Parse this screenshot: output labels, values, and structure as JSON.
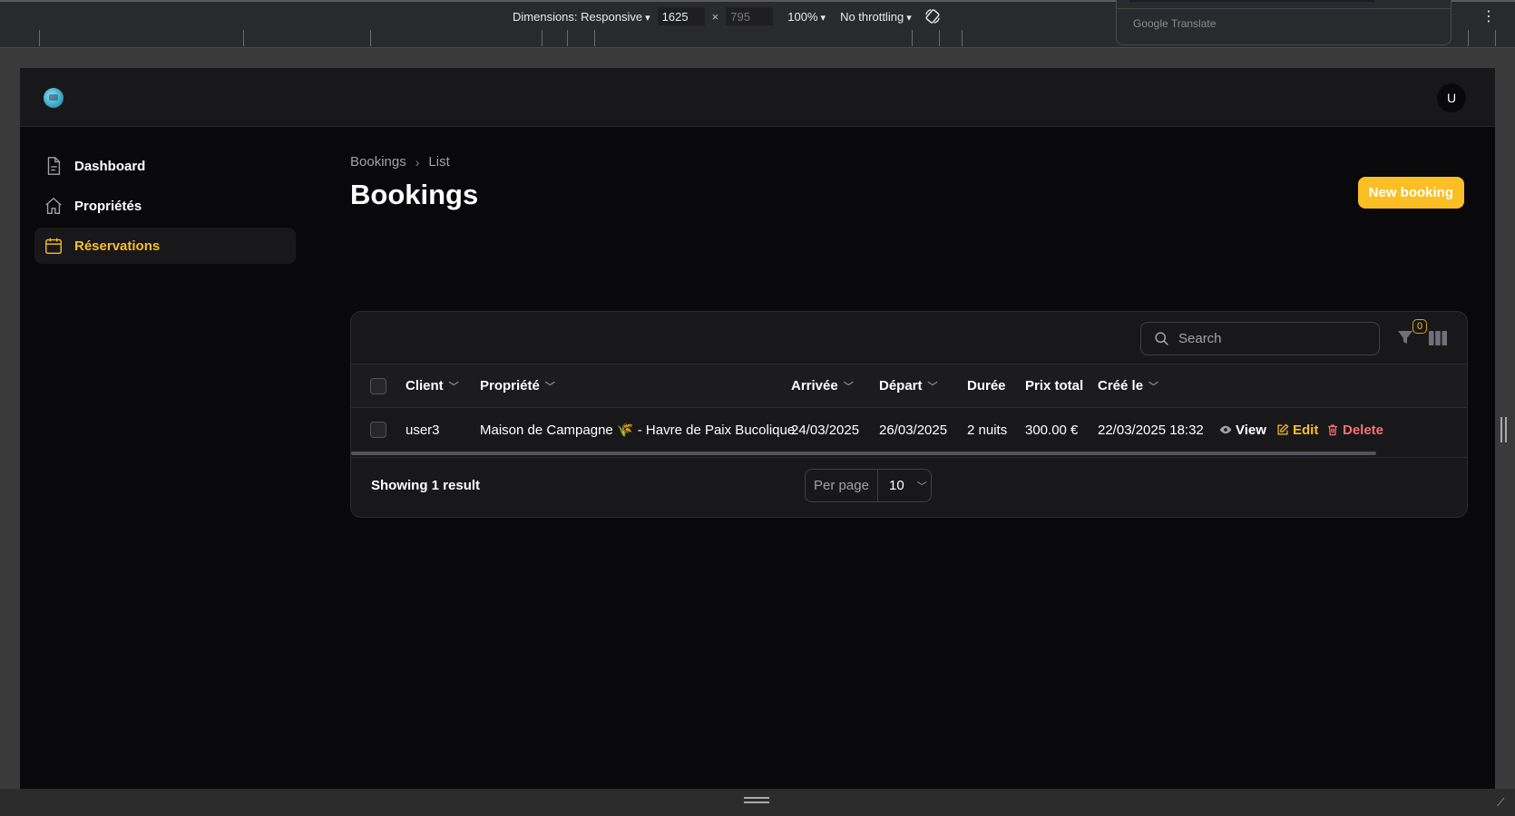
{
  "devtools": {
    "dimensions_label": "Dimensions: Responsive",
    "width_value": "1625",
    "height_value": "795",
    "times": "×",
    "zoom": "100%",
    "throttling": "No throttling",
    "translate_label": "Google Translate"
  },
  "header": {
    "avatar_initial": "U"
  },
  "sidebar": {
    "items": [
      {
        "label": "Dashboard",
        "icon": "document-icon",
        "active": false
      },
      {
        "label": "Propriétés",
        "icon": "home-icon",
        "active": false
      },
      {
        "label": "Réservations",
        "icon": "calendar-icon",
        "active": true
      }
    ]
  },
  "breadcrumb": {
    "root": "Bookings",
    "separator": "›",
    "current": "List"
  },
  "page": {
    "title": "Bookings",
    "new_button": "New booking"
  },
  "table": {
    "search_placeholder": "Search",
    "filter_count": "0",
    "columns": [
      "Client",
      "Propriété",
      "Arrivée",
      "Départ",
      "Durée",
      "Prix total",
      "Créé le"
    ],
    "rows": [
      {
        "client": "user3",
        "property": "Maison de Campagne 🌾 - Havre de Paix Bucolique",
        "arrival": "24/03/2025",
        "departure": "26/03/2025",
        "duration": "2 nuits",
        "total": "300.00 €",
        "created": "22/03/2025 18:32"
      }
    ],
    "actions": {
      "view": "View",
      "edit": "Edit",
      "delete": "Delete"
    },
    "showing": "Showing 1 result",
    "per_page_label": "Per page",
    "per_page_value": "10"
  },
  "colors": {
    "accent": "#fbbf24",
    "danger": "#f87171",
    "background": "#09090b",
    "surface": "#18181b"
  }
}
